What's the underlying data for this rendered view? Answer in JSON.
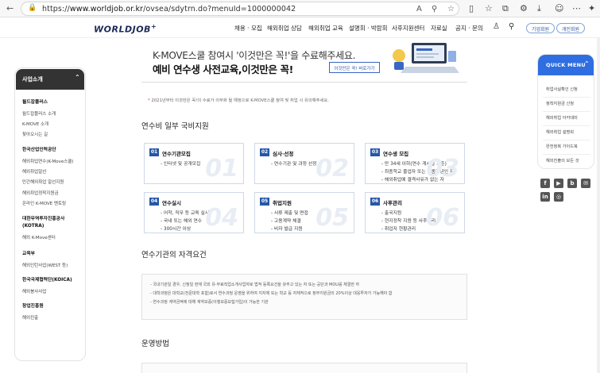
{
  "browser": {
    "url_prefix": "https://",
    "url_domain": "www.worldjob.or.kr",
    "url_path": "/ovsea/sdytrn.do?menuId=1000000042"
  },
  "header": {
    "logo": "WORLDJOB",
    "logo_mark": "+",
    "nav": [
      "채용 · 모집",
      "해외취업 상담",
      "해외취업 교육",
      "설명회 · 박람회",
      "사후지원센터",
      "자료실",
      "공지 · 문의"
    ],
    "corp_member": "기업회원",
    "personal_member": "개인회원"
  },
  "sidebar": {
    "title": "사업소개",
    "groups": [
      {
        "label": "월드잡플러스",
        "items": [
          "월드잡플러스 소개",
          "K-MOVE 소개",
          "찾아오시는 길"
        ]
      },
      {
        "label": "한국산업인력공단",
        "items": [
          "해외취업연수(K-Move스쿨)",
          "해외취업알선",
          "민간해외취업 알선지원",
          "해외취업정착지원금",
          "온라인 K-MOVE 멘토링"
        ]
      },
      {
        "label": "대한무역투자진흥공사 (KOTRA)",
        "items": [
          "해외 K-Move센터"
        ]
      },
      {
        "label": "교육부",
        "items": [
          "해외인턴사업(WEST 등)"
        ]
      },
      {
        "label": "한국국제협력단(KOICA)",
        "items": [
          "해외봉사사업"
        ]
      },
      {
        "label": "창업진흥원",
        "items": [
          "해외진출"
        ]
      }
    ]
  },
  "banner": {
    "line1": "K-MOVE스쿨 참여시 '이것만은 꼭!'을 수료해주세요.",
    "line2": "예비 연수생 사전교육,이것만은 꼭!",
    "button": "이것만은 꼭! 바로가기"
  },
  "notice": {
    "star": "*",
    "text": "2021년부터 이것만은 꼭!의 수료가 의무화 될 예정으로 K-MOVE스쿨 참여 및 취업 시 유의해주세요."
  },
  "section1": {
    "title": "연수비 일부 국비지원",
    "steps": [
      {
        "num": "01",
        "title": "연수기관모집",
        "lines": [
          "- 인터넷 및 공개모집"
        ]
      },
      {
        "num": "02",
        "title": "심사·선정",
        "lines": [
          "- 연수기관 및 과정 선정"
        ]
      },
      {
        "num": "03",
        "title": "연수생 모집",
        "lines": [
          "- 만 34세 이하(연수 게시일 기준)",
          "- 최종학교 졸업자 또는 최종학년인 자",
          "- 해외취업에 결격사유가 없는 자"
        ]
      },
      {
        "num": "04",
        "title": "연수실시",
        "lines": [
          "- 어학, 직무 등 교육 실시",
          "- 국내 또는 해외 연수",
          "- 300시간 이상"
        ]
      },
      {
        "num": "05",
        "title": "취업지원",
        "lines": [
          "- 서류 제출 및 면접",
          "- 고용계약 체결",
          "- 비자 발급 지원"
        ]
      },
      {
        "num": "06",
        "title": "사후관리",
        "lines": [
          "- 출국지원",
          "- 현지정착 지원 등 사후관리",
          "- 취업자 현황관리"
        ]
      }
    ]
  },
  "section2": {
    "title": "연수기관의 자격요건",
    "lines": [
      "- 국내기관일 경우, 신청일 현재 국외 유·무료직업소개사업자로 법적 등록요건을 갖추고 있는 자 또는 공단과 MOU를 체결한 자",
      "- 대학과정은 대학교(전문대학 포함)로서 연수과정 운영을 위하여 지자체 또는 학교 등 자체적으로 정부지원금의 20%이상 대응투자가 가능해야 함",
      "- 연수과정 계약금액에 대해 계약보증(이행보증보험가입)이 가능한 기관"
    ]
  },
  "section3": {
    "title": "운영방법"
  },
  "quick_menu": {
    "title": "QUICK MENU",
    "items": [
      "취업사실확인 신청",
      "정착지원금 신청",
      "해외취업 아카데미",
      "해외취업 설명회",
      "완전정복 가이드북",
      "해외진출의 모든 것"
    ]
  },
  "sns": [
    {
      "name": "facebook",
      "glyph": "f"
    },
    {
      "name": "youtube",
      "glyph": "▶"
    },
    {
      "name": "blog",
      "glyph": "b"
    },
    {
      "name": "talk",
      "glyph": "✉"
    },
    {
      "name": "linkedin",
      "glyph": "in"
    },
    {
      "name": "instagram",
      "glyph": "◎"
    }
  ]
}
